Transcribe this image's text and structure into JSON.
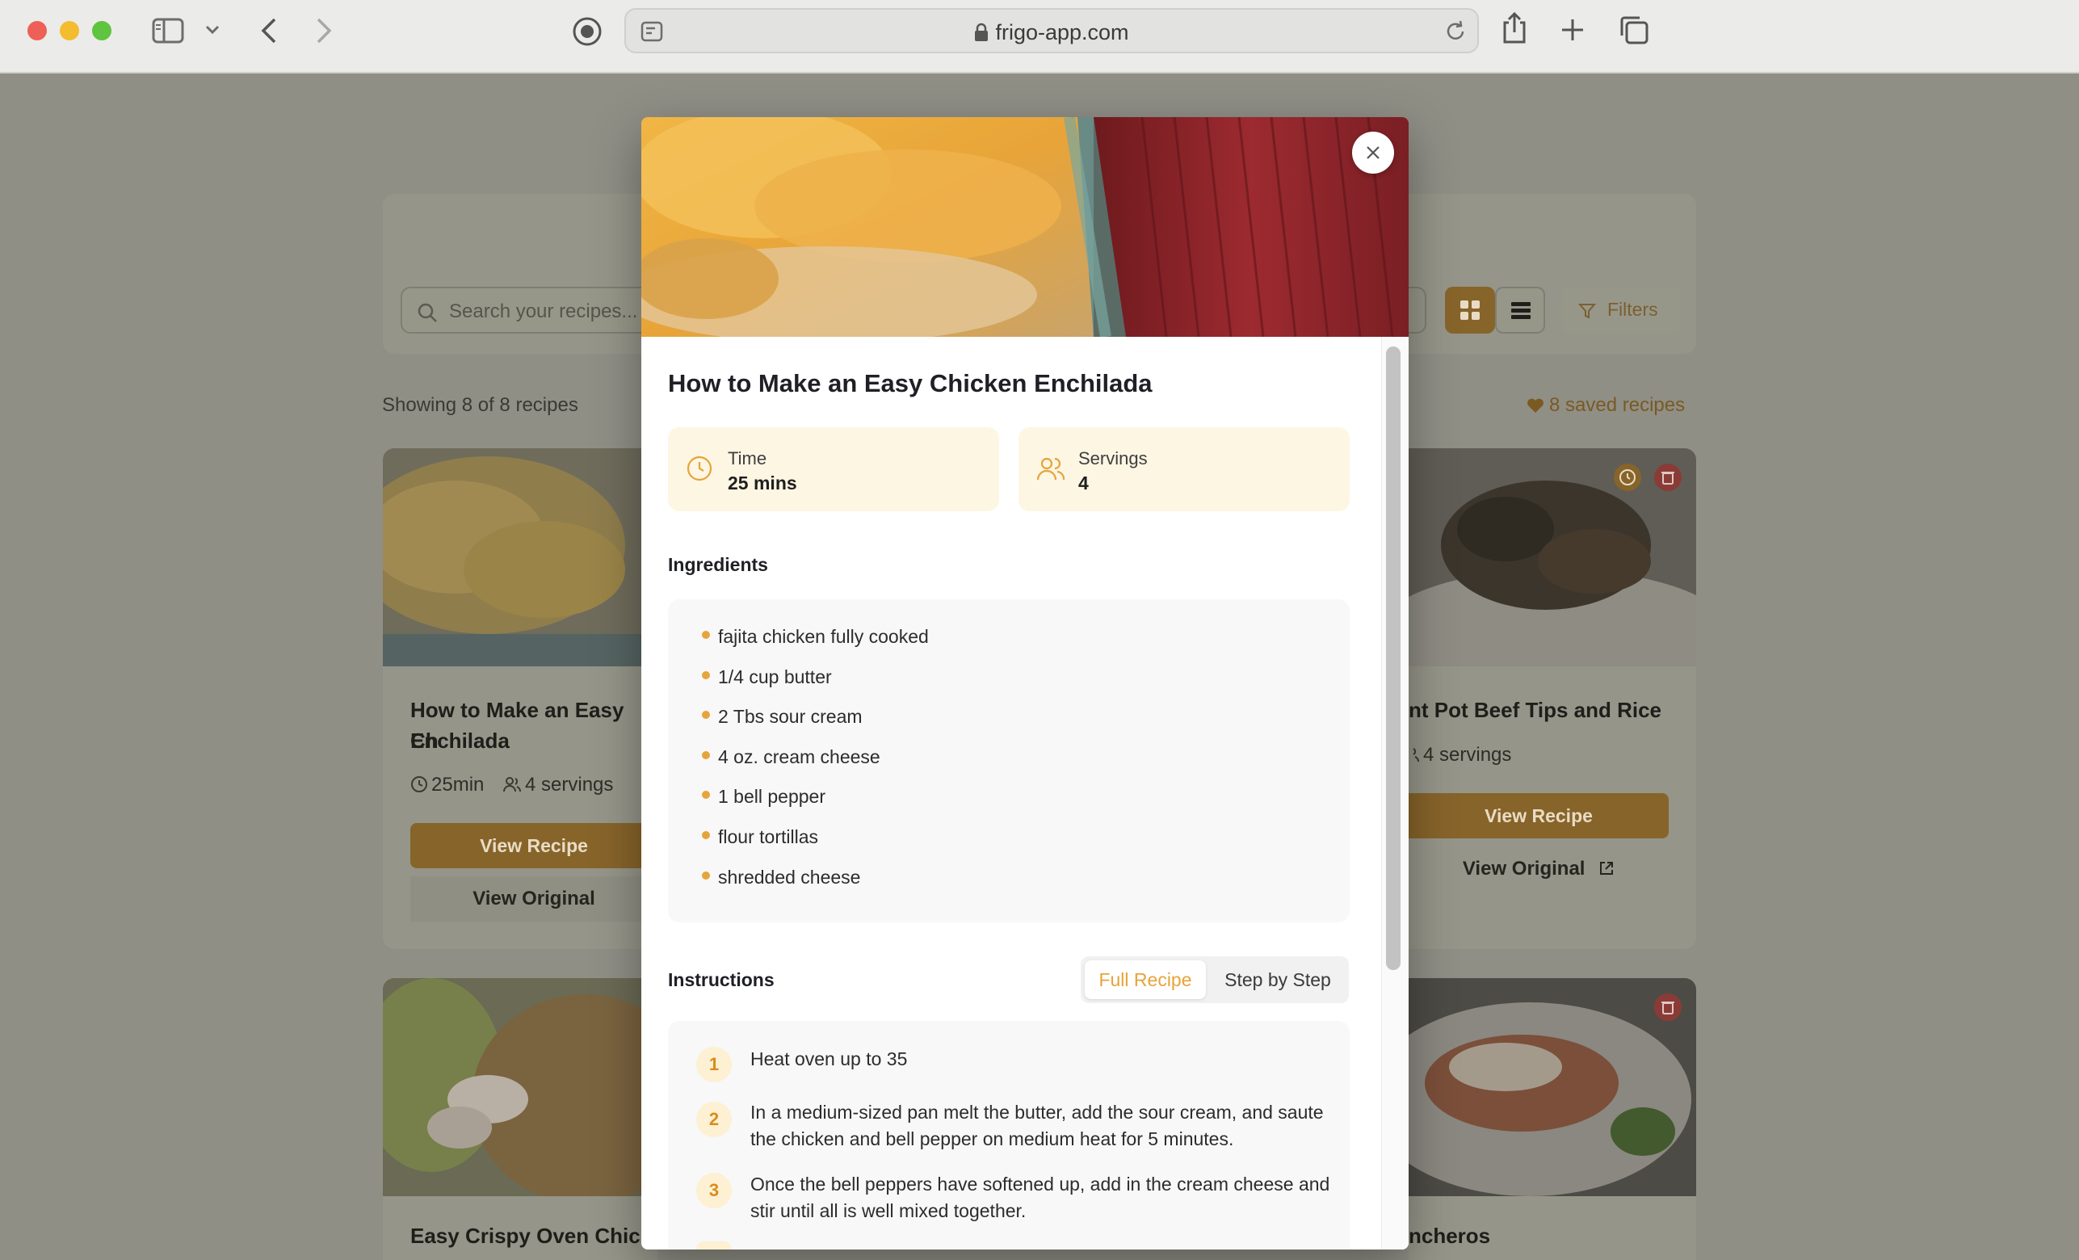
{
  "browser": {
    "url": "frigo-app.com"
  },
  "page": {
    "search_placeholder": "Search your recipes...",
    "filters_label": "Filters",
    "showing_text": "Showing 8 of 8 recipes",
    "saved_text": "8 saved recipes",
    "cards": [
      {
        "title_line1": "How to Make an Easy Ch",
        "title_line2": "Enchilada",
        "time": "25min",
        "servings": "4 servings",
        "view_recipe": "View Recipe",
        "view_original": "View Original"
      },
      {
        "title": "nt Pot Beef Tips and Rice",
        "servings": "4 servings",
        "view_recipe": "View Recipe",
        "view_original": "View Original"
      },
      {
        "title": "Easy Crispy Oven Chick"
      },
      {
        "title": "ncheros"
      }
    ]
  },
  "modal": {
    "title": "How to Make an Easy Chicken Enchilada",
    "time_label": "Time",
    "time_value": "25 mins",
    "servings_label": "Servings",
    "servings_value": "4",
    "ingredients_heading": "Ingredients",
    "ingredients": [
      "fajita chicken fully cooked",
      "1/4 cup butter",
      "2 Tbs sour cream",
      "4 oz. cream cheese",
      "1 bell pepper",
      "flour tortillas",
      "shredded cheese"
    ],
    "instructions_heading": "Instructions",
    "tab_full": "Full Recipe",
    "tab_step": "Step by Step",
    "steps": [
      {
        "n": "1",
        "text": "Heat oven up to 35"
      },
      {
        "n": "2",
        "text": "In a medium-sized pan melt the butter, add the sour cream, and saute the chicken and bell pepper on medium heat for 5 minutes."
      },
      {
        "n": "3",
        "text": "Once the bell peppers have softened up, add in the cream cheese and stir until all is well mixed together."
      }
    ]
  },
  "colors": {
    "accent": "#e6a43a",
    "accent_light": "#fdf6e3",
    "overlay": "#8f8f86"
  }
}
